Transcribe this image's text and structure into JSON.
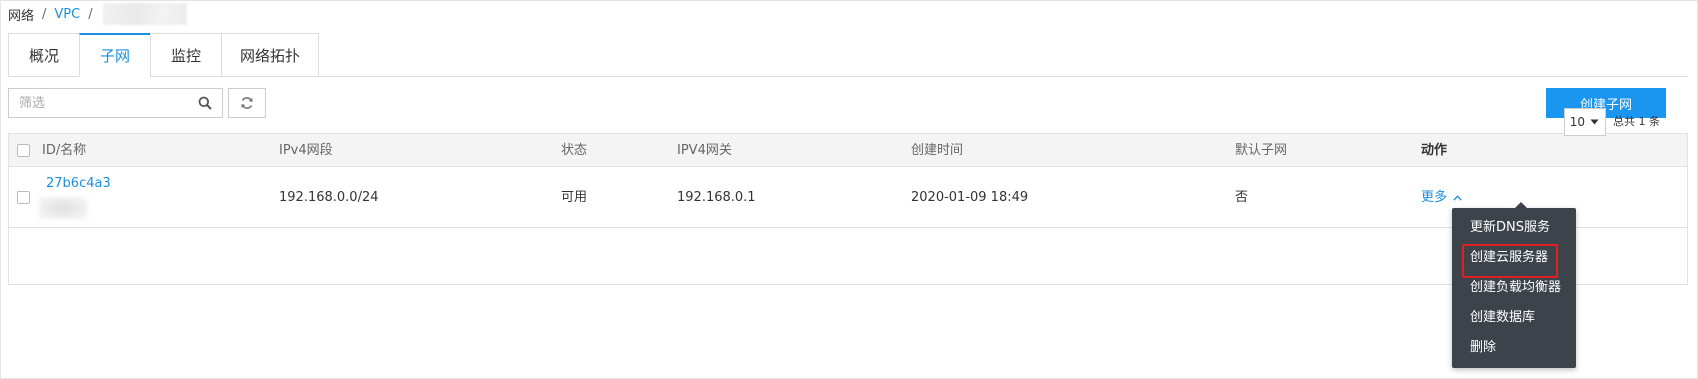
{
  "breadcrumb": {
    "root": "网络",
    "sep1": "/",
    "vpc": "VPC",
    "sep2": "/"
  },
  "tabs": [
    {
      "label": "概况",
      "active": false
    },
    {
      "label": "子网",
      "active": true
    },
    {
      "label": "监控",
      "active": false
    },
    {
      "label": "网络拓扑",
      "active": false
    }
  ],
  "toolbar": {
    "filter_placeholder": "筛选",
    "create_label": "创建子网"
  },
  "table": {
    "headers": {
      "id": "ID/名称",
      "cidr": "IPv4网段",
      "status": "状态",
      "gateway": "IPV4网关",
      "created": "创建时间",
      "default": "默认子网",
      "action": "动作"
    },
    "rows": [
      {
        "id": "27b6c4a3",
        "cidr": "192.168.0.0/24",
        "status": "可用",
        "gateway": "192.168.0.1",
        "created": "2020-01-09 18:49",
        "default": "否",
        "more": "更多"
      }
    ]
  },
  "pagination": {
    "page_size": "10",
    "total": "总共 1 条"
  },
  "more_menu": {
    "items": [
      {
        "label": "更新DNS服务",
        "highlight": false
      },
      {
        "label": "创建云服务器",
        "highlight": true
      },
      {
        "label": "创建负载均衡器",
        "highlight": false
      },
      {
        "label": "创建数据库",
        "highlight": false
      },
      {
        "label": "删除",
        "highlight": false
      }
    ]
  },
  "colors": {
    "accent": "#1a8fe0",
    "button": "#1a95f0",
    "menu_bg": "#3d434b",
    "highlight_border": "#e02020"
  }
}
